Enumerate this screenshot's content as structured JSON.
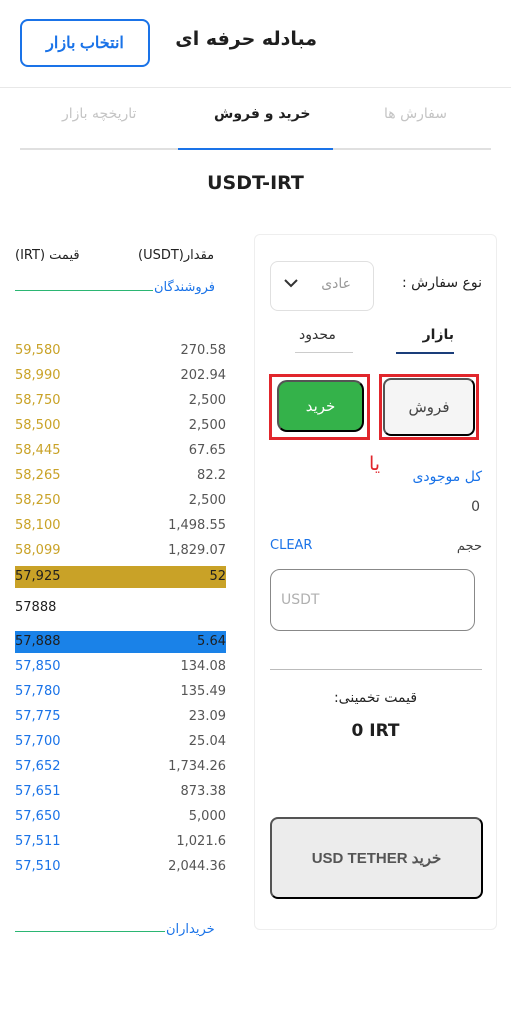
{
  "header": {
    "title": "مبادله حرفه ای",
    "select_market_label": "انتخاب بازار"
  },
  "tabs": [
    {
      "label": "سفارش ها",
      "active": false
    },
    {
      "label": "خرید و فروش",
      "active": true
    },
    {
      "label": "تاریخچه بازار",
      "active": false
    }
  ],
  "symbol": "USDT-IRT",
  "order_book": {
    "qty_header": "مقدار(USDT)",
    "price_header": "قیمت (IRT)",
    "sellers_label": "فروشندگان",
    "buyers_label": "خریداران",
    "asks": [
      {
        "price": "59,580",
        "qty": "270.58"
      },
      {
        "price": "58,990",
        "qty": "202.94"
      },
      {
        "price": "58,750",
        "qty": "2,500"
      },
      {
        "price": "58,500",
        "qty": "2,500"
      },
      {
        "price": "58,445",
        "qty": "67.65"
      },
      {
        "price": "58,265",
        "qty": "82.2"
      },
      {
        "price": "58,250",
        "qty": "2,500"
      },
      {
        "price": "58,100",
        "qty": "1,498.55"
      },
      {
        "price": "58,099",
        "qty": "1,829.07"
      },
      {
        "price": "57,925",
        "qty": "52"
      }
    ],
    "last_price": "57888",
    "bids": [
      {
        "price": "57,888",
        "qty": "5.64"
      },
      {
        "price": "57,850",
        "qty": "134.08"
      },
      {
        "price": "57,780",
        "qty": "135.49"
      },
      {
        "price": "57,775",
        "qty": "23.09"
      },
      {
        "price": "57,700",
        "qty": "25.04"
      },
      {
        "price": "57,652",
        "qty": "1,734.26"
      },
      {
        "price": "57,651",
        "qty": "873.38"
      },
      {
        "price": "57,650",
        "qty": "5,000"
      },
      {
        "price": "57,511",
        "qty": "1,021.6"
      },
      {
        "price": "57,510",
        "qty": "2,044.36"
      }
    ]
  },
  "order_panel": {
    "order_type_label": "نوع سفارش :",
    "order_type_value": "عادی",
    "market_tab": "بازار",
    "limit_tab": "محدود",
    "sell_label": "فروش",
    "buy_label": "خرید",
    "annotation": "یا",
    "balance_label": "کل موجودی",
    "balance_value": "0",
    "clear_label": "CLEAR",
    "volume_label": "حجم",
    "volume_placeholder": "USDT",
    "estimate_label": "قیمت تخمینی:",
    "estimate_value": "0 IRT",
    "submit_label": "خرید USD TETHER"
  },
  "colors": {
    "accent": "#1a73e8",
    "sell_price": "#c9a227",
    "buy_button": "#34b24a",
    "annotation_red": "#e1262c",
    "divider_green": "#2bb673"
  }
}
